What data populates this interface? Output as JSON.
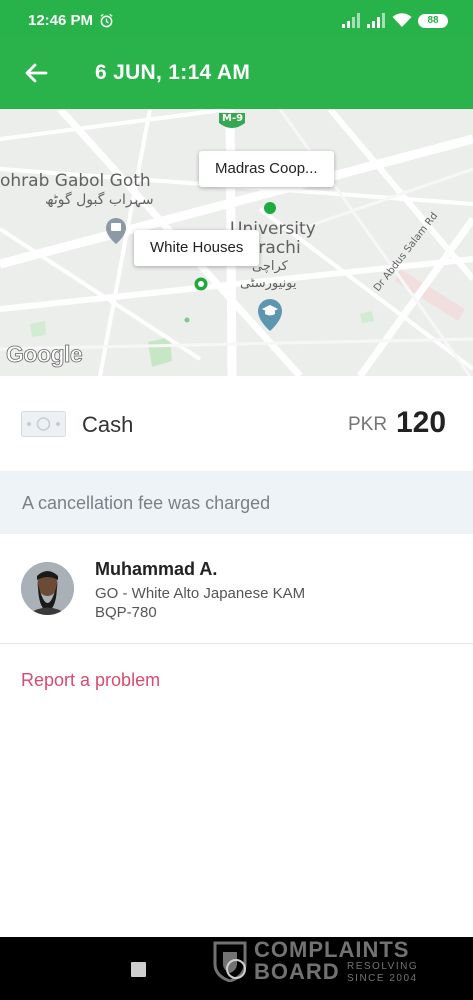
{
  "status_bar": {
    "time": "12:46 PM",
    "alarm_icon": "alarm-clock-icon",
    "signal_icon": "signal-icon",
    "wifi_icon": "wifi-icon",
    "battery": "88"
  },
  "app_bar": {
    "back_icon": "arrow-left-icon",
    "title": "6 JUN, 1:14 AM"
  },
  "map": {
    "labels": {
      "m9": "M-9",
      "sohrab_en": "ohrab Gabol Goth",
      "sohrab_ur": "سہراب گبول گوٹھ",
      "university_en_1": "University",
      "university_en_2": "arachi",
      "university_ur_1": "کراچی",
      "university_ur_2": "یونیورسٹی",
      "road": "Dr Abdus Salam Rd"
    },
    "pickup_label": "Madras Coop...",
    "dropoff_label": "White Houses",
    "attribution": "Google"
  },
  "payment": {
    "method_icon": "cash-icon",
    "method": "Cash",
    "currency": "PKR",
    "amount": "120"
  },
  "notice": "A cancellation fee was charged",
  "driver": {
    "avatar": "driver-avatar",
    "name": "Muhammad A.",
    "vehicle": "GO - White Alto Japanese KAM",
    "plate": "BQP-780"
  },
  "report_link": "Report a problem",
  "nav": {
    "recent_icon": "square-icon",
    "home_icon": "circle-icon"
  },
  "watermark": {
    "line1": "COMPLAINTS",
    "line2": "BOARD",
    "tag1": "RESOLVING",
    "tag2": "SINCE 2004"
  },
  "colors": {
    "primary_green": "#2bb34b",
    "report_pink": "#d84a6f",
    "notice_bg": "#eef3f7"
  }
}
